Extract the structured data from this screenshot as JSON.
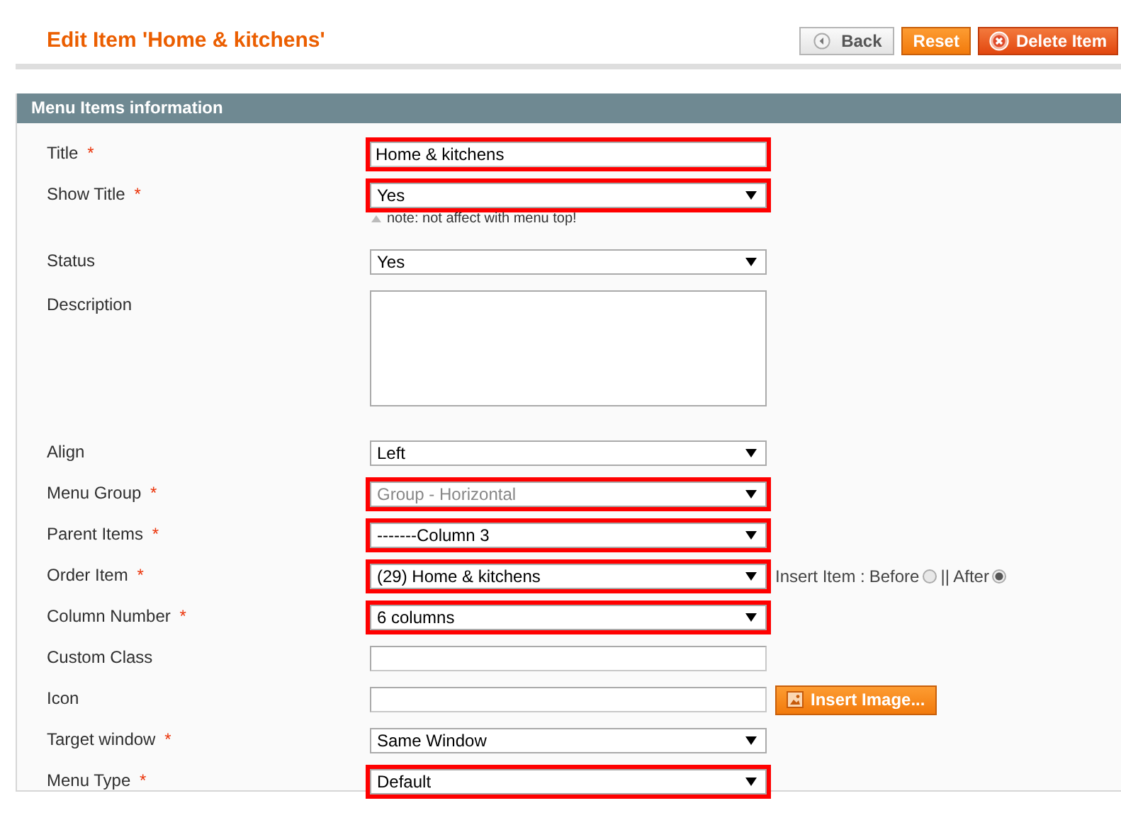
{
  "page_title": "Edit Item 'Home & kitchens'",
  "buttons": [
    {
      "kind": "back",
      "label": "Back"
    },
    {
      "kind": "reset",
      "label": "Reset"
    },
    {
      "kind": "delete",
      "label": "Delete Item"
    }
  ],
  "section": {
    "title": "Menu Items information",
    "fields": [
      {
        "kind": "text",
        "label": "Title",
        "mark": "*",
        "value": "Home & kitchens",
        "highlighted": true
      },
      {
        "kind": "select",
        "label": "Show Title",
        "mark": "*",
        "value": "Yes",
        "highlighted": true,
        "note": "note: not affect with menu top!"
      },
      {
        "kind": "select",
        "label": "Status",
        "value": "Yes",
        "highlighted": false
      },
      {
        "kind": "textarea",
        "label": "Description",
        "highlighted": false
      },
      {
        "kind": "select",
        "label": "Align",
        "value": "Left",
        "highlighted": false
      },
      {
        "kind": "select",
        "label": "Menu Group",
        "mark": "*",
        "value": "Group - Horizontal",
        "highlighted": true,
        "disabled": true
      },
      {
        "kind": "select",
        "label": "Parent Items",
        "mark": "*",
        "value": "-------Column 3",
        "highlighted": true
      },
      {
        "kind": "select",
        "label": "Order Item",
        "mark": "*",
        "value": "(29) Home & kitchens",
        "highlighted": true,
        "insert": {
          "label": "Insert Item :",
          "options": [
            {
              "label": "Before",
              "selected": false
            },
            {
              "label": "|| After",
              "selected": true
            }
          ]
        }
      },
      {
        "kind": "select",
        "label": "Column Number",
        "mark": "*",
        "value": "6 columns",
        "highlighted": true
      },
      {
        "kind": "text",
        "label": "Custom Class",
        "highlighted": false
      },
      {
        "kind": "text",
        "label": "Icon",
        "highlighted": false,
        "button": "Insert Image..."
      },
      {
        "kind": "select",
        "label": "Target window",
        "mark": "*",
        "value": "Same Window",
        "highlighted": false
      },
      {
        "kind": "select",
        "label": "Menu Type",
        "mark": "*",
        "value": "Default",
        "highlighted": true
      }
    ]
  }
}
